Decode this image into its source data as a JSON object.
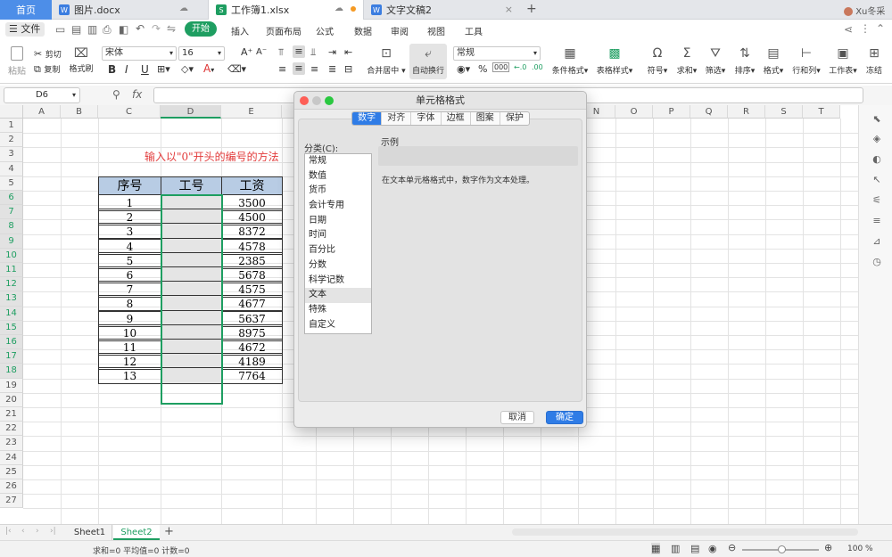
{
  "tabs": {
    "home": "首页",
    "doc1": "图片.docx",
    "xlsx": "工作簿1.xlsx",
    "doc2": "文字文稿2",
    "add": "+",
    "user": "Xu冬采"
  },
  "ribbon": {
    "file": "文件",
    "tabs": [
      "开始",
      "插入",
      "页面布局",
      "公式",
      "数据",
      "审阅",
      "视图",
      "工具"
    ],
    "paste": "粘贴",
    "cut": "剪切",
    "copy": "复制",
    "format_painter": "格式刷",
    "font_name": "宋体",
    "font_size": "16",
    "bold": "B",
    "italic": "I",
    "underline": "U",
    "merge": "合并居中",
    "wrap": "自动换行",
    "number_format": "常规",
    "cond_format": "条件格式",
    "table_style": "表格样式",
    "symbol": "符号",
    "sum": "求和",
    "filter": "筛选",
    "sort": "排序",
    "format": "格式",
    "rowcol": "行和列",
    "sheet": "工作表",
    "freeze": "冻结"
  },
  "formula_bar": {
    "cell_ref": "D6",
    "fx": "fx",
    "value": ""
  },
  "grid": {
    "columns": [
      "A",
      "B",
      "C",
      "D",
      "E",
      "F",
      "G",
      "H",
      "I",
      "J",
      "K",
      "L",
      "M",
      "N",
      "O",
      "P",
      "Q",
      "R",
      "S",
      "T"
    ],
    "rows": [
      "1",
      "2",
      "3",
      "4",
      "5",
      "6",
      "7",
      "8",
      "9",
      "10",
      "11",
      "12",
      "13",
      "14",
      "15",
      "16",
      "17",
      "18",
      "19",
      "20",
      "21",
      "22",
      "23",
      "24",
      "25",
      "26",
      "27"
    ],
    "title": "输入以\"0\"开头的编号的方法",
    "headers": [
      "序号",
      "工号",
      "工资"
    ],
    "data": [
      [
        "1",
        "",
        "3500"
      ],
      [
        "2",
        "",
        "4500"
      ],
      [
        "3",
        "",
        "8372"
      ],
      [
        "4",
        "",
        "4578"
      ],
      [
        "5",
        "",
        "2385"
      ],
      [
        "6",
        "",
        "5678"
      ],
      [
        "7",
        "",
        "4575"
      ],
      [
        "8",
        "",
        "4677"
      ],
      [
        "9",
        "",
        "5637"
      ],
      [
        "10",
        "",
        "8975"
      ],
      [
        "11",
        "",
        "4672"
      ],
      [
        "12",
        "",
        "4189"
      ],
      [
        "13",
        "",
        "7764"
      ]
    ]
  },
  "dialog": {
    "title": "单元格格式",
    "tabs": [
      "数字",
      "对齐",
      "字体",
      "边框",
      "图案",
      "保护"
    ],
    "category_label": "分类(C):",
    "categories": [
      "常规",
      "数值",
      "货币",
      "会计专用",
      "日期",
      "时间",
      "百分比",
      "分数",
      "科学记数",
      "文本",
      "特殊",
      "自定义"
    ],
    "selected_category": "文本",
    "sample_label": "示例",
    "description": "在文本单元格格式中，数字作为文本处理。",
    "cancel": "取消",
    "ok": "确定"
  },
  "sheets": [
    "Sheet1",
    "Sheet2"
  ],
  "active_sheet": "Sheet2",
  "status": {
    "stats": "求和=0  平均值=0  计数=0",
    "zoom": "100 %"
  },
  "colors": {
    "accent": "#2f7ce6",
    "header_fill": "#b8cce4",
    "selected_fill": "#e5e5e5",
    "red_text": "#e23b3b",
    "green": "#1e9e61"
  }
}
